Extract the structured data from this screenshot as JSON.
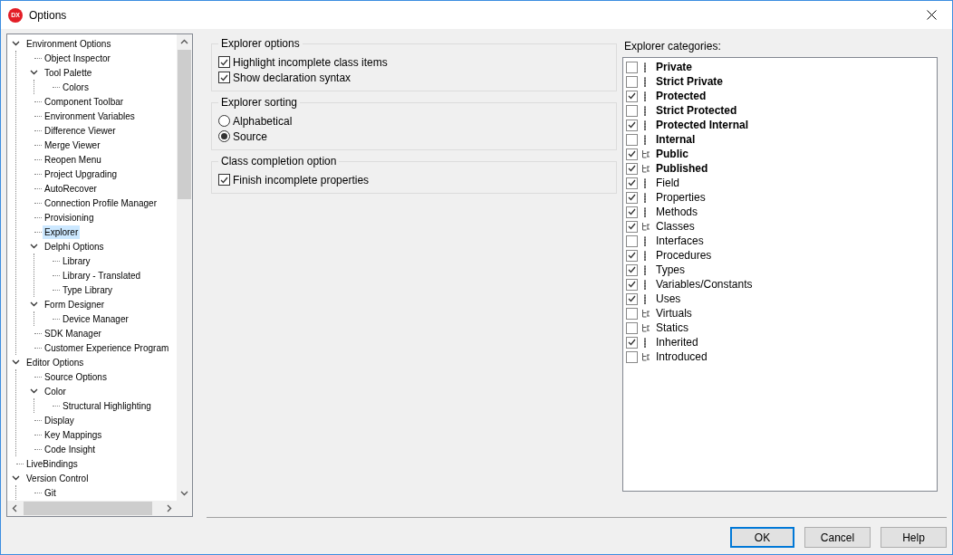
{
  "window": {
    "title": "Options",
    "logo": "DX"
  },
  "tree": [
    {
      "label": "Environment Options",
      "expanded": true,
      "selected": false,
      "children": [
        {
          "label": "Object Inspector",
          "selected": false
        },
        {
          "label": "Tool Palette",
          "expanded": true,
          "selected": false,
          "children": [
            {
              "label": "Colors",
              "selected": false
            }
          ]
        },
        {
          "label": "Component Toolbar",
          "selected": false
        },
        {
          "label": "Environment Variables",
          "selected": false
        },
        {
          "label": "Difference Viewer",
          "selected": false
        },
        {
          "label": "Merge Viewer",
          "selected": false
        },
        {
          "label": "Reopen Menu",
          "selected": false
        },
        {
          "label": "Project Upgrading",
          "selected": false
        },
        {
          "label": "AutoRecover",
          "selected": false
        },
        {
          "label": "Connection Profile Manager",
          "selected": false
        },
        {
          "label": "Provisioning",
          "selected": false
        },
        {
          "label": "Explorer",
          "selected": true
        },
        {
          "label": "Delphi Options",
          "expanded": true,
          "selected": false,
          "children": [
            {
              "label": "Library",
              "selected": false
            },
            {
              "label": "Library - Translated",
              "selected": false
            },
            {
              "label": "Type Library",
              "selected": false
            }
          ]
        },
        {
          "label": "Form Designer",
          "expanded": true,
          "selected": false,
          "children": [
            {
              "label": "Device Manager",
              "selected": false
            }
          ]
        },
        {
          "label": "SDK Manager",
          "selected": false
        },
        {
          "label": "Customer Experience Program",
          "selected": false
        }
      ]
    },
    {
      "label": "Editor Options",
      "expanded": true,
      "selected": false,
      "children": [
        {
          "label": "Source Options",
          "selected": false
        },
        {
          "label": "Color",
          "expanded": true,
          "selected": false,
          "children": [
            {
              "label": "Structural Highlighting",
              "selected": false
            }
          ]
        },
        {
          "label": "Display",
          "selected": false
        },
        {
          "label": "Key Mappings",
          "selected": false
        },
        {
          "label": "Code Insight",
          "selected": false
        }
      ]
    },
    {
      "label": "LiveBindings",
      "selected": false
    },
    {
      "label": "Version Control",
      "expanded": true,
      "selected": false,
      "children": [
        {
          "label": "Git",
          "selected": false
        }
      ]
    }
  ],
  "groups": [
    {
      "title": "Explorer options",
      "items": [
        {
          "kind": "checkbox",
          "label": "Highlight incomplete class items",
          "checked": true
        },
        {
          "kind": "checkbox",
          "label": "Show declaration syntax",
          "checked": true
        }
      ]
    },
    {
      "title": "Explorer sorting",
      "items": [
        {
          "kind": "radio",
          "label": "Alphabetical",
          "selected": false
        },
        {
          "kind": "radio",
          "label": "Source",
          "selected": true
        }
      ]
    },
    {
      "title": "Class completion option",
      "items": [
        {
          "kind": "checkbox",
          "label": "Finish incomplete properties",
          "checked": true
        }
      ]
    }
  ],
  "categories": {
    "label": "Explorer categories:",
    "items": [
      {
        "label": "Private",
        "checked": false,
        "bold": true,
        "kind": "members"
      },
      {
        "label": "Strict Private",
        "checked": false,
        "bold": true,
        "kind": "members"
      },
      {
        "label": "Protected",
        "checked": true,
        "bold": true,
        "kind": "members"
      },
      {
        "label": "Strict Protected",
        "checked": false,
        "bold": true,
        "kind": "members"
      },
      {
        "label": "Protected Internal",
        "checked": true,
        "bold": true,
        "kind": "members"
      },
      {
        "label": "Internal",
        "checked": false,
        "bold": true,
        "kind": "members"
      },
      {
        "label": "Public",
        "checked": true,
        "bold": true,
        "kind": "hierarchy"
      },
      {
        "label": "Published",
        "checked": true,
        "bold": true,
        "kind": "hierarchy"
      },
      {
        "label": "Field",
        "checked": true,
        "bold": false,
        "kind": "members"
      },
      {
        "label": "Properties",
        "checked": true,
        "bold": false,
        "kind": "members"
      },
      {
        "label": "Methods",
        "checked": true,
        "bold": false,
        "kind": "members"
      },
      {
        "label": "Classes",
        "checked": true,
        "bold": false,
        "kind": "hierarchy"
      },
      {
        "label": "Interfaces",
        "checked": false,
        "bold": false,
        "kind": "members"
      },
      {
        "label": "Procedures",
        "checked": true,
        "bold": false,
        "kind": "members"
      },
      {
        "label": "Types",
        "checked": true,
        "bold": false,
        "kind": "members"
      },
      {
        "label": "Variables/Constants",
        "checked": true,
        "bold": false,
        "kind": "members"
      },
      {
        "label": "Uses",
        "checked": true,
        "bold": false,
        "kind": "members"
      },
      {
        "label": "Virtuals",
        "checked": false,
        "bold": false,
        "kind": "hierarchy"
      },
      {
        "label": "Statics",
        "checked": false,
        "bold": false,
        "kind": "hierarchy"
      },
      {
        "label": "Inherited",
        "checked": true,
        "bold": false,
        "kind": "members"
      },
      {
        "label": "Introduced",
        "checked": false,
        "bold": false,
        "kind": "hierarchy"
      }
    ]
  },
  "buttons": [
    {
      "label": "OK",
      "default": true
    },
    {
      "label": "Cancel",
      "default": false
    },
    {
      "label": "Help",
      "default": false
    }
  ]
}
